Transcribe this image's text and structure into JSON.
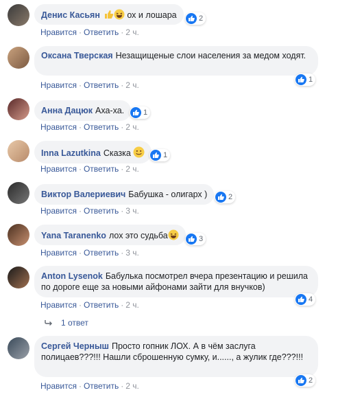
{
  "labels": {
    "like": "Нравится",
    "reply": "Ответить",
    "sep": "·"
  },
  "comments": [
    {
      "author": "Денис Касьян",
      "text": "ох и лошара",
      "emojis": [
        "thumbs-up-emoji",
        "laughing-emoji"
      ],
      "count": "2",
      "time": "2 ч."
    },
    {
      "author": "Оксана Тверская",
      "text": "Незащищеные слои населения за медом ходят.",
      "count": "1",
      "time": "2 ч."
    },
    {
      "author": "Анна Дацюк",
      "text": "Аха-ха.",
      "count": "1",
      "time": "2 ч."
    },
    {
      "author": "Inna Lazutkina",
      "text": "Сказка",
      "emojis": [
        "smiling-emoji"
      ],
      "count": "1",
      "time": "2 ч."
    },
    {
      "author": "Виктор Валериевич",
      "text": "Бабушка - олигарх )",
      "count": "2",
      "time": "3 ч."
    },
    {
      "author": "Yana Taranenko",
      "text": "лох это судьба",
      "emojis": [
        "laughing-emoji"
      ],
      "count": "3",
      "time": "3 ч."
    },
    {
      "author": "Anton Lysenok",
      "text": "Бабулька посмотрел вчера презентацию и решила по дороге еще за новыми айфонами зайти для внучков)",
      "count": "4",
      "time": "2 ч."
    },
    {
      "author": "Сергей Черныш",
      "text": "Просто гопник ЛОХ. А в чём заслуга полицаев???!!! Нашли сброшенную сумку, и......, а жулик где???!!!",
      "count": "2",
      "time": "2 ч."
    }
  ],
  "replies_link": "1 ответ",
  "colors": {
    "link": "#385898",
    "bubble": "#f2f3f5",
    "like_blue": "#1877f2",
    "meta": "#90949c"
  }
}
